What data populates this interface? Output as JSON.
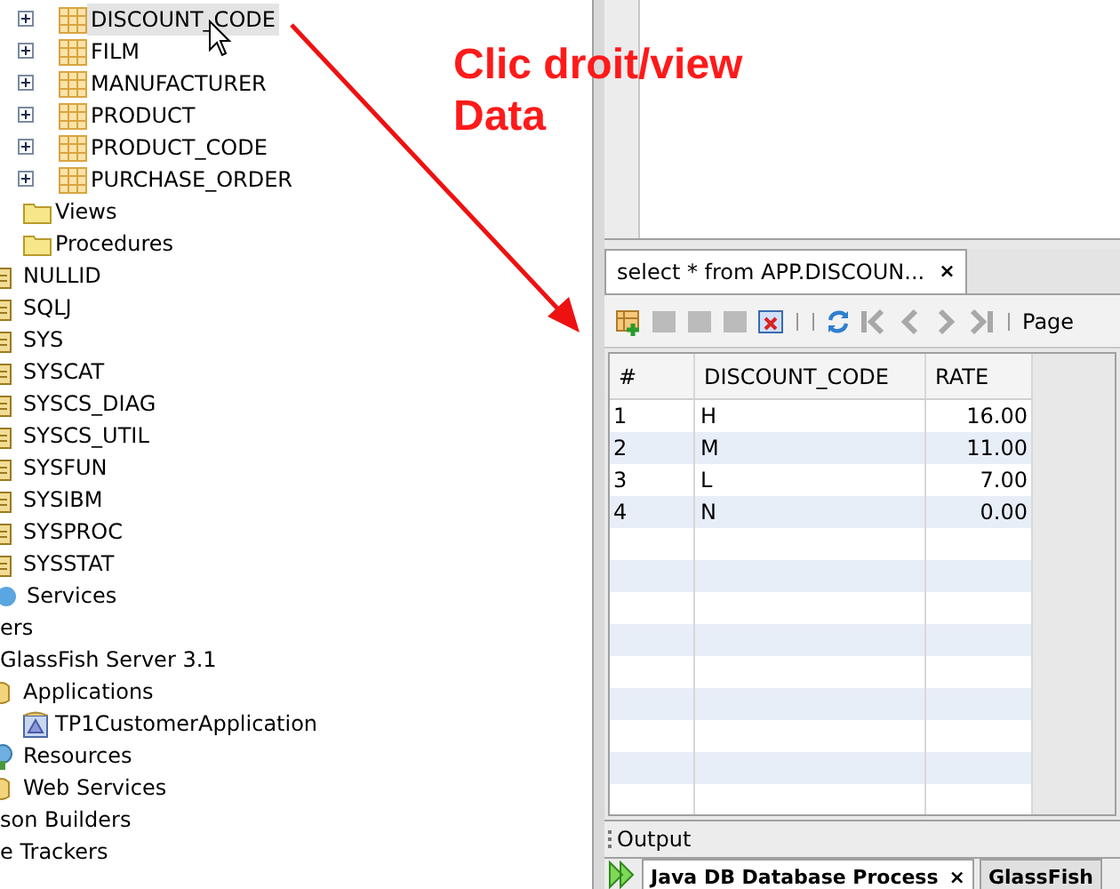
{
  "tree": [
    {
      "children": [
        {
          "children": [
            {
              "children": [
                {
                  "children": [
                    {
                      "label": "DISCOUNT_CODE",
                      "kind": "table",
                      "expanded": false,
                      "selected": true
                    },
                    {
                      "label": "FILM",
                      "kind": "table",
                      "expanded": false,
                      "selected": false
                    },
                    {
                      "label": "MANUFACTURER",
                      "kind": "table",
                      "expanded": false,
                      "selected": false
                    },
                    {
                      "label": "PRODUCT",
                      "kind": "table",
                      "expanded": false,
                      "selected": false
                    },
                    {
                      "label": "PRODUCT_CODE",
                      "kind": "table",
                      "expanded": false,
                      "selected": false
                    },
                    {
                      "label": "PURCHASE_ORDER",
                      "kind": "table",
                      "expanded": false,
                      "selected": false
                    }
                  ]
                },
                {
                  "label": "Views",
                  "kind": "folder",
                  "selected": false
                },
                {
                  "label": "Procedures",
                  "kind": "folder",
                  "selected": false
                }
              ]
            },
            {
              "label": "NULLID",
              "kind": "schema",
              "selected": false
            },
            {
              "label": "SQLJ",
              "kind": "schema",
              "selected": false
            },
            {
              "label": "SYS",
              "kind": "schema",
              "selected": false
            },
            {
              "label": "SYSCAT",
              "kind": "schema",
              "selected": false
            },
            {
              "label": "SYSCS_DIAG",
              "kind": "schema",
              "selected": false
            },
            {
              "label": "SYSCS_UTIL",
              "kind": "schema",
              "selected": false
            },
            {
              "label": "SYSFUN",
              "kind": "schema",
              "selected": false
            },
            {
              "label": "SYSIBM",
              "kind": "schema",
              "selected": false
            },
            {
              "label": "SYSPROC",
              "kind": "schema",
              "selected": false
            },
            {
              "label": "SYSSTAT",
              "kind": "schema",
              "selected": false
            }
          ]
        }
      ]
    },
    {
      "label": "Services",
      "kind": "service",
      "selected": false
    },
    {
      "label": "ers",
      "selected": false,
      "children": [
        {
          "label": "GlassFish Server 3.1",
          "selected": false,
          "children": [
            {
              "label": "Applications",
              "kind": "folder-apps",
              "selected": false,
              "children": [
                {
                  "label": "TP1CustomerApplication",
                  "kind": "app",
                  "selected": false
                }
              ]
            },
            {
              "label": "Resources",
              "kind": "globe",
              "selected": false
            },
            {
              "label": "Web Services",
              "kind": "folder-apps",
              "selected": false
            }
          ]
        }
      ]
    },
    {
      "label": "son Builders",
      "selected": false
    },
    {
      "label": "e Trackers",
      "selected": false
    }
  ],
  "annotation": {
    "lines": [
      "Clic droit/view",
      "Data"
    ]
  },
  "editor_tab": {
    "label": "select * from APP.DISCOUN...",
    "close": "×",
    "selected": true
  },
  "toolbar": [
    {
      "kind": "insert",
      "disabled": false
    },
    {
      "kind": "square",
      "disabled": true
    },
    {
      "kind": "square",
      "disabled": true
    },
    {
      "kind": "square",
      "disabled": true
    },
    {
      "kind": "delete",
      "disabled": false
    },
    {
      "kind": "refresh",
      "disabled": false
    },
    {
      "kind": "first",
      "disabled": true
    },
    {
      "kind": "prev",
      "disabled": true
    },
    {
      "kind": "next",
      "disabled": true
    },
    {
      "kind": "last",
      "disabled": true
    }
  ],
  "page_label": "Page",
  "table": {
    "columns": [
      "#",
      "DISCOUNT_CODE",
      "RATE"
    ],
    "rows": [
      [
        "1",
        "H",
        "16.00"
      ],
      [
        "2",
        "M",
        "11.00"
      ],
      [
        "3",
        "L",
        "7.00"
      ],
      [
        "4",
        "N",
        "0.00"
      ]
    ]
  },
  "output": {
    "title": "Output",
    "tabs": [
      {
        "label": "Java DB Database Process",
        "close": "×",
        "selected": true
      },
      {
        "label": "GlassFish",
        "selected": false
      }
    ]
  }
}
